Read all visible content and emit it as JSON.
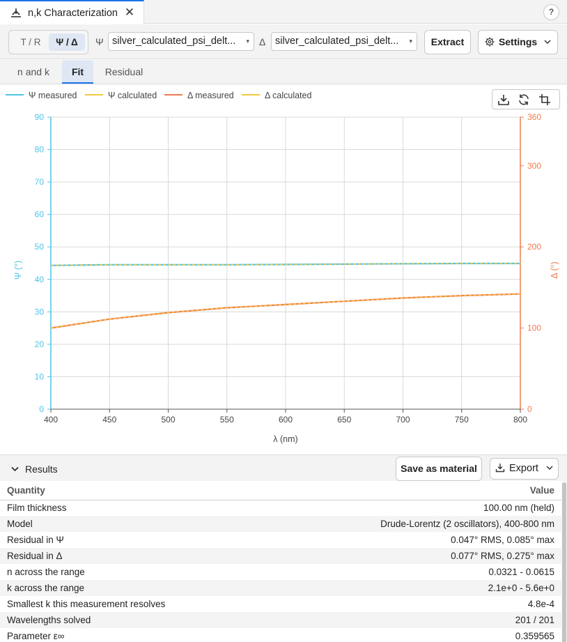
{
  "window": {
    "tab_title": "n,k Characterization",
    "close_glyph": "✕",
    "help_label": "?"
  },
  "toolbar": {
    "mode_tr": "T / R",
    "mode_psi_delta": "Ψ / Δ",
    "psi_symbol": "Ψ",
    "psi_file": "silver_calculated_psi_delt...",
    "delta_symbol": "Δ",
    "delta_file": "silver_calculated_psi_delt...",
    "extract_label": "Extract",
    "settings_label": "Settings"
  },
  "subtabs": [
    {
      "label": "n and k",
      "active": false
    },
    {
      "label": "Fit",
      "active": true
    },
    {
      "label": "Residual",
      "active": false
    }
  ],
  "chart_data": {
    "type": "line",
    "legend": [
      {
        "name": "Ψ measured",
        "color": "#4cc4e8"
      },
      {
        "name": "Ψ calculated",
        "color": "#f4c842"
      },
      {
        "name": "Δ measured",
        "color": "#f07a4e"
      },
      {
        "name": "Δ calculated",
        "color": "#f4c842"
      }
    ],
    "xlabel": "λ (nm)",
    "ylabel_left": "Ψ (°)",
    "ylabel_right": "Δ (°)",
    "xlim": [
      400,
      800
    ],
    "ylim_left": [
      0,
      90
    ],
    "ylim_right": [
      0,
      360
    ],
    "x_ticks": [
      400,
      450,
      500,
      550,
      600,
      650,
      700,
      750,
      800
    ],
    "y_left_ticks": [
      0,
      10,
      20,
      30,
      40,
      50,
      60,
      70,
      80,
      90
    ],
    "y_right_ticks": [
      0,
      100,
      200,
      300,
      360
    ],
    "grid": true,
    "series": [
      {
        "name": "Ψ measured",
        "axis": "left",
        "color": "#4cc4e8",
        "x": [
          400,
          450,
          500,
          550,
          600,
          650,
          700,
          750,
          800
        ],
        "y": [
          44.3,
          44.5,
          44.5,
          44.5,
          44.6,
          44.7,
          44.8,
          44.9,
          44.9
        ]
      },
      {
        "name": "Ψ calculated",
        "axis": "left",
        "color": "#f4c842",
        "x": [
          400,
          450,
          500,
          550,
          600,
          650,
          700,
          750,
          800
        ],
        "y": [
          44.3,
          44.5,
          44.5,
          44.5,
          44.6,
          44.7,
          44.8,
          44.9,
          44.9
        ]
      },
      {
        "name": "Δ measured",
        "axis": "right",
        "color": "#f07a4e",
        "x": [
          400,
          450,
          500,
          550,
          600,
          650,
          700,
          750,
          800
        ],
        "y": [
          100,
          111,
          119,
          125,
          129,
          133,
          137,
          140,
          142
        ]
      },
      {
        "name": "Δ calculated",
        "axis": "right",
        "color": "#f4c842",
        "x": [
          400,
          450,
          500,
          550,
          600,
          650,
          700,
          750,
          800
        ],
        "y": [
          100,
          111,
          119,
          125,
          129,
          133,
          137,
          140,
          142
        ]
      }
    ]
  },
  "results": {
    "title": "Results",
    "save_label": "Save as material",
    "export_label": "Export",
    "columns": {
      "quantity": "Quantity",
      "value": "Value"
    },
    "rows": [
      {
        "q": "Film thickness",
        "v": "100.00 nm (held)"
      },
      {
        "q": "Model",
        "v": "Drude-Lorentz (2 oscillators), 400-800 nm"
      },
      {
        "q": "Residual in Ψ",
        "v": "0.047° RMS, 0.085° max"
      },
      {
        "q": "Residual in Δ",
        "v": "0.077° RMS, 0.275° max"
      },
      {
        "q": "n across the range",
        "v": "0.0321 - 0.0615"
      },
      {
        "q": "k across the range",
        "v": "2.1e+0 - 5.6e+0"
      },
      {
        "q": "Smallest k this measurement resolves",
        "v": "4.8e-4"
      },
      {
        "q": "Wavelengths solved",
        "v": "201 / 201"
      },
      {
        "q": "Parameter ε∞",
        "v": "0.359565"
      }
    ]
  }
}
